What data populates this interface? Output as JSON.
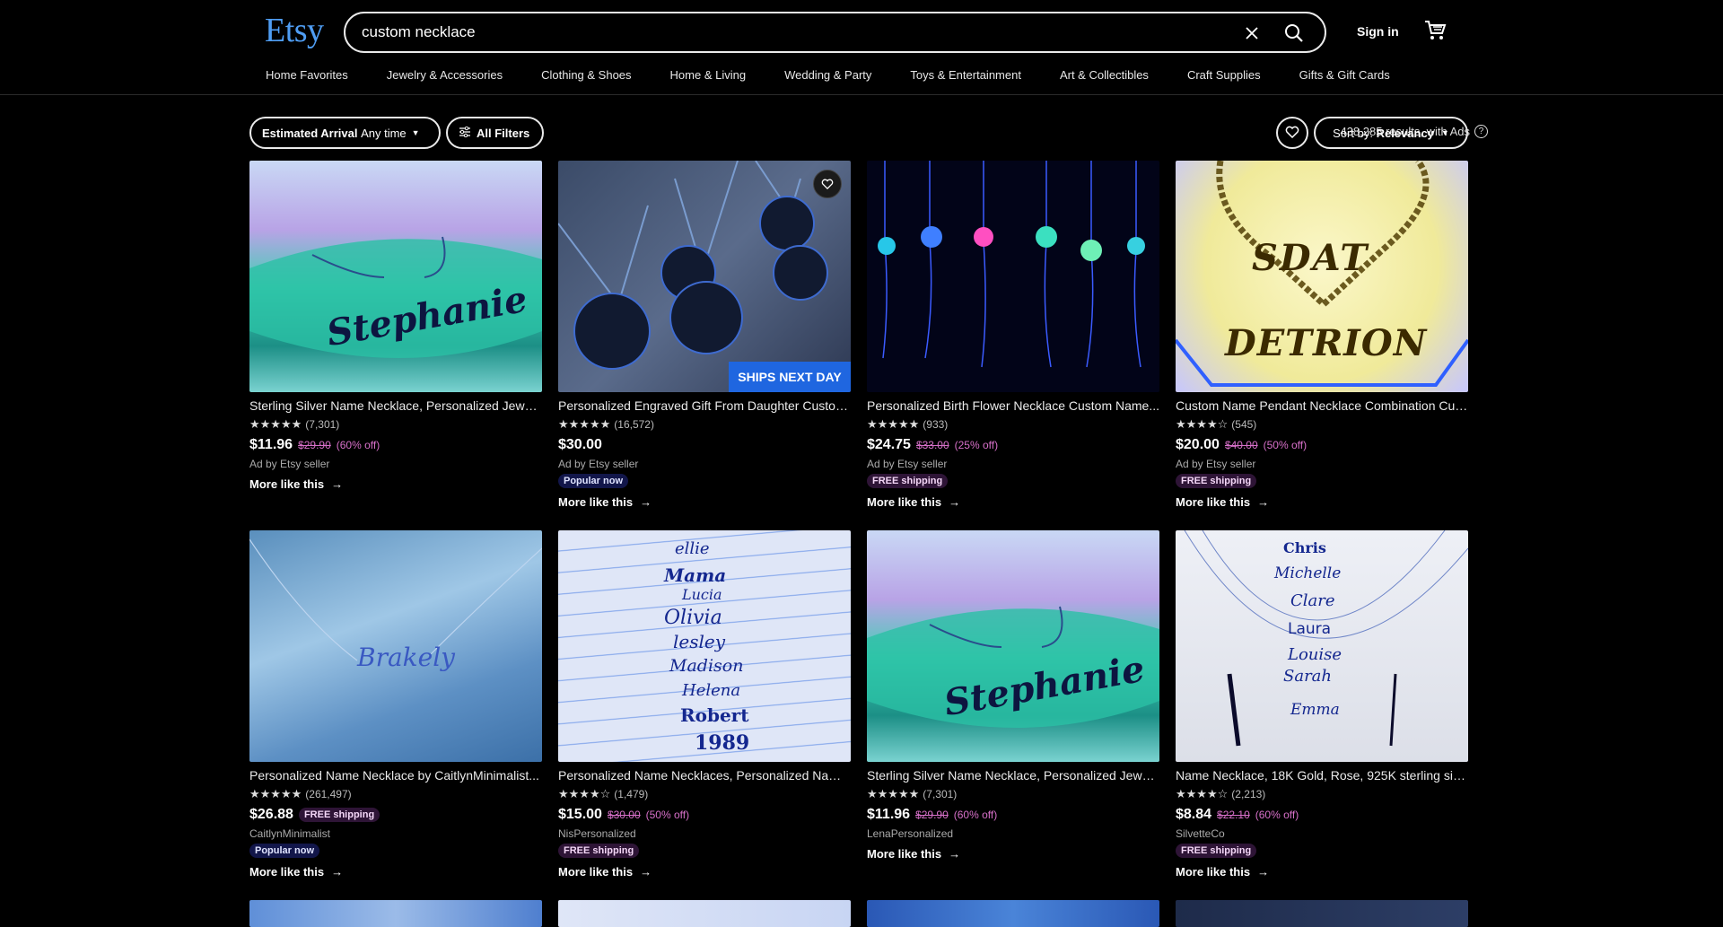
{
  "header": {
    "logo": "Etsy",
    "search_value": "custom necklace",
    "sign_in": "Sign in"
  },
  "nav": [
    "Home Favorites",
    "Jewelry & Accessories",
    "Clothing & Shoes",
    "Home & Living",
    "Wedding & Party",
    "Toys & Entertainment",
    "Art & Collectibles",
    "Craft Supplies",
    "Gifts & Gift Cards"
  ],
  "filters": {
    "arrival_label": "Estimated Arrival",
    "arrival_value": "Any time",
    "all_filters": "All Filters",
    "results": "438,285 results, with Ads",
    "sort_label": "Sort by:",
    "sort_value": "Relevancy"
  },
  "listings": [
    {
      "title": "Sterling Silver Name Necklace, Personalized Jewelry...",
      "reviews": "(7,301)",
      "stars": 5,
      "price": "$11.96",
      "was": "$29.90",
      "off": "(60% off)",
      "seller": "Ad by Etsy seller",
      "badge": "",
      "more": "More like this",
      "thumb_text": "Stephanie"
    },
    {
      "title": "Personalized Engraved Gift From Daughter Custom...",
      "reviews": "(16,572)",
      "stars": 5,
      "price": "$30.00",
      "was": "",
      "off": "",
      "seller": "Ad by Etsy seller",
      "badge": "Popular now",
      "more": "More like this",
      "overlay": "SHIPS NEXT DAY"
    },
    {
      "title": "Personalized Birth Flower Necklace Custom Name...",
      "reviews": "(933)",
      "stars": 5,
      "price": "$24.75",
      "was": "$33.00",
      "off": "(25% off)",
      "seller": "Ad by Etsy seller",
      "badge": "FREE shipping",
      "more": "More like this"
    },
    {
      "title": "Custom Name Pendant Necklace Combination Cuban...",
      "reviews": "(545)",
      "stars": 4.5,
      "price": "$20.00",
      "was": "$40.00",
      "off": "(50% off)",
      "seller": "Ad by Etsy seller",
      "badge": "FREE shipping",
      "more": "More like this",
      "thumb_text": "SDAT",
      "thumb_text2": "DETRION"
    },
    {
      "title": "Personalized Name Necklace by CaitlynMinimalist...",
      "reviews": "(261,497)",
      "stars": 5,
      "price": "$26.88",
      "inline_badge": "FREE shipping",
      "seller": "CaitlynMinimalist",
      "badge": "Popular now",
      "more": "More like this",
      "thumb_text": "Brakely"
    },
    {
      "title": "Personalized Name Necklaces, Personalized Name...",
      "reviews": "(1,479)",
      "stars": 4.5,
      "price": "$15.00",
      "was": "$30.00",
      "off": "(50% off)",
      "seller": "NisPersonalized",
      "badge": "FREE shipping",
      "more": "More like this",
      "names": [
        "ellie",
        "Mama",
        "Lucia",
        "Olivia",
        "lesley",
        "Madison",
        "Helena",
        "Robert",
        "1989"
      ]
    },
    {
      "title": "Sterling Silver Name Necklace, Personalized Jewelry...",
      "reviews": "(7,301)",
      "stars": 5,
      "price": "$11.96",
      "was": "$29.90",
      "off": "(60% off)",
      "seller": "LenaPersonalized",
      "badge": "",
      "more": "More like this",
      "thumb_text": "Stephanie"
    },
    {
      "title": "Name Necklace, 18K Gold, Rose, 925K sterling silver...",
      "reviews": "(2,213)",
      "stars": 4.5,
      "price": "$8.84",
      "was": "$22.10",
      "off": "(60% off)",
      "seller": "SilvetteCo",
      "badge": "FREE shipping",
      "more": "More like this",
      "names": [
        "Chris",
        "Michelle",
        "Clare",
        "Laura",
        "Louise",
        "Sarah",
        "Emma"
      ]
    }
  ],
  "colors": {
    "brand": "#4f9df3",
    "sale": "#d770c9"
  }
}
